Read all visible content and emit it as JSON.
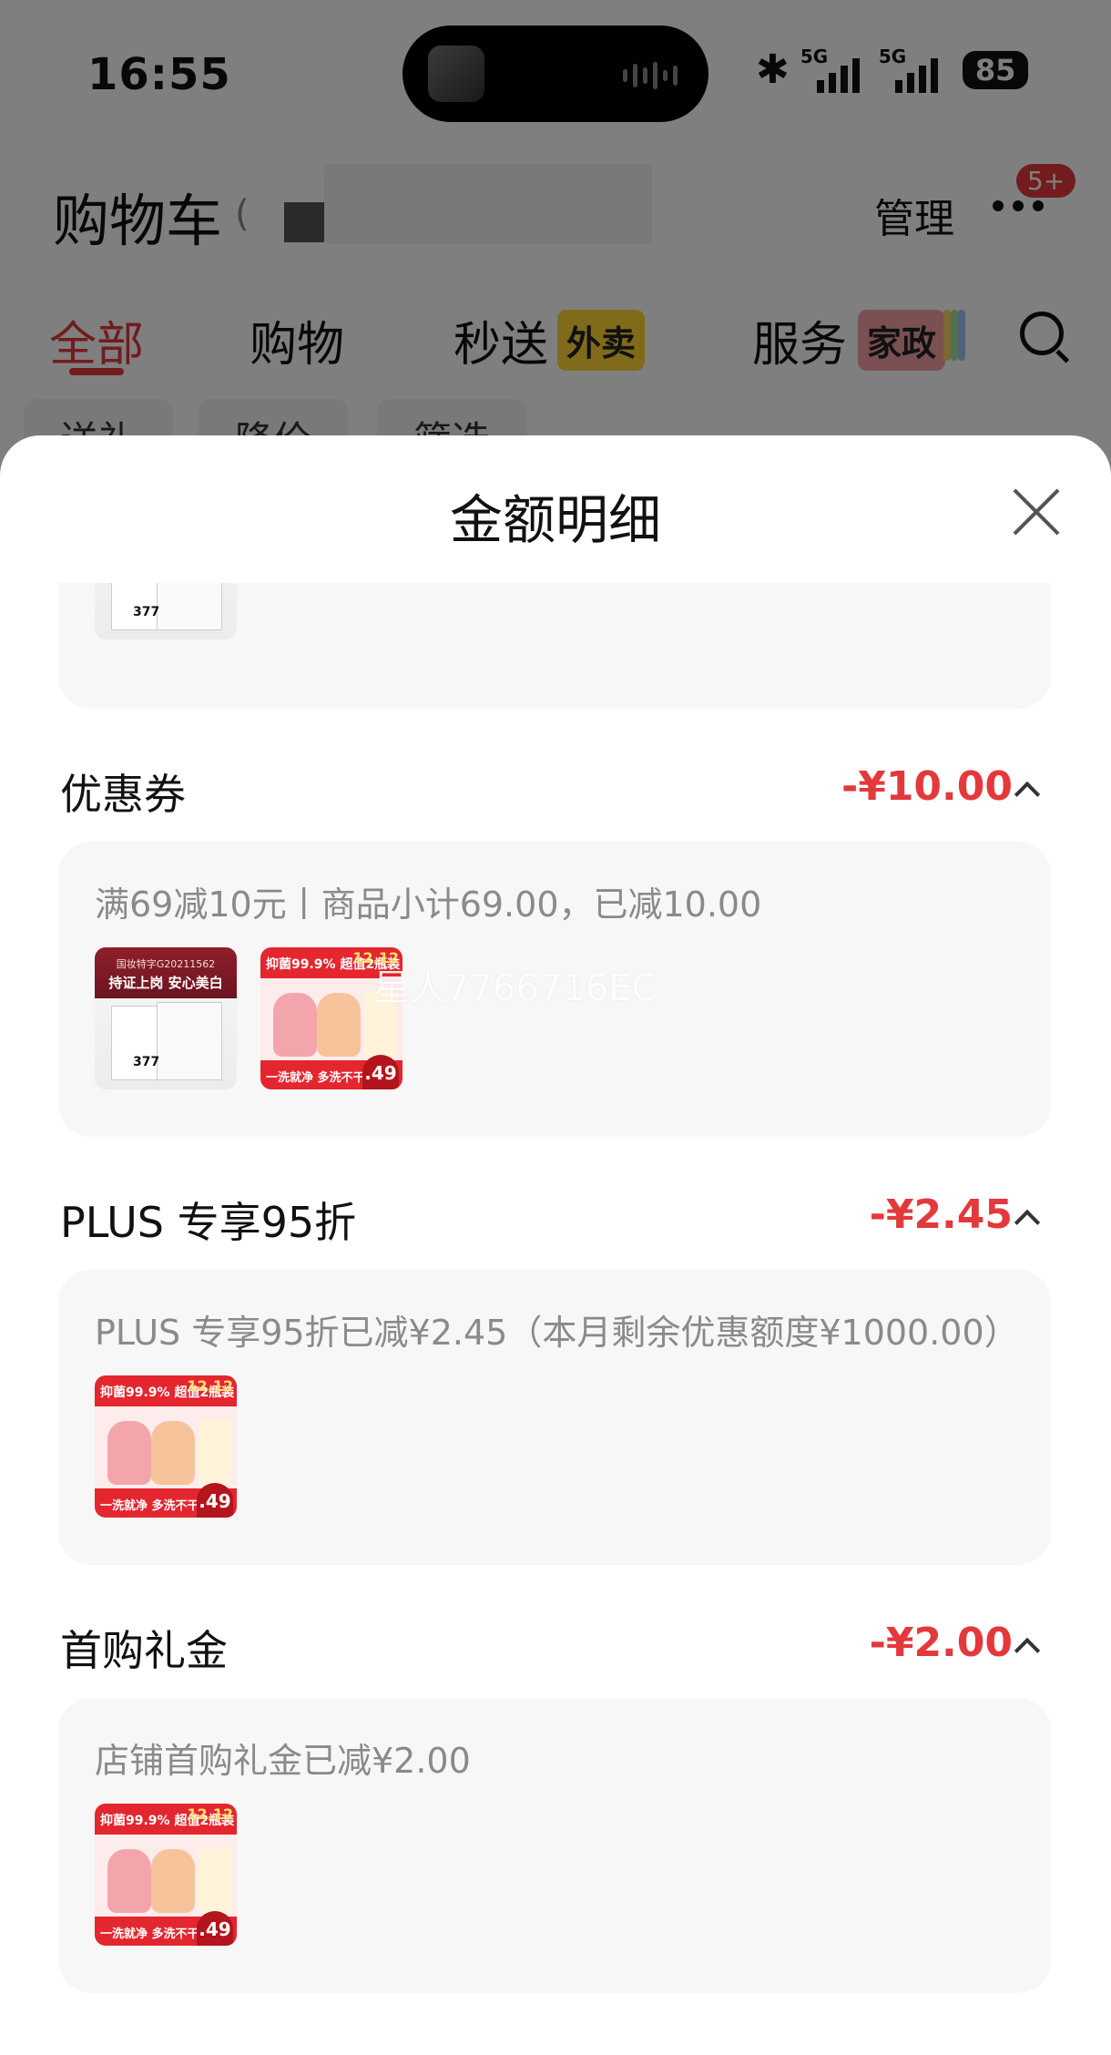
{
  "status_bar": {
    "time": "16:55",
    "network1": "5G",
    "network2": "5G",
    "battery": "85"
  },
  "header": {
    "title": "购物车",
    "count_partial": "(",
    "manage": "管理",
    "msg_badge": "5+"
  },
  "tabs": [
    {
      "label": "全部",
      "active": true
    },
    {
      "label": "购物"
    },
    {
      "label": "秒送",
      "tag": "外卖"
    },
    {
      "label": "服务",
      "tag": "家政"
    }
  ],
  "chips": [
    "送礼",
    "降价",
    "筛选"
  ],
  "sheet": {
    "title": "金额明细",
    "sections": [
      {
        "label": "优惠券",
        "amount": "-¥10.00",
        "desc": "满69减10元丨商品小计69.00，已减10.00",
        "products": [
          "product-a",
          "product-b"
        ]
      },
      {
        "label": "PLUS 专享95折",
        "amount": "-¥2.45",
        "desc": "PLUS 专享95折已减¥2.45（本月剩余优惠额度¥1000.00）",
        "products": [
          "product-b"
        ]
      },
      {
        "label": "首购礼金",
        "amount": "-¥2.00",
        "desc": "店铺首购礼金已减¥2.00",
        "products": [
          "product-b"
        ]
      }
    ]
  },
  "product_a": {
    "line1": "国妆特字G20211562",
    "line2": "持证上岗 安心美白",
    "num": "377"
  },
  "product_b": {
    "title": "抑菌99.9% 超值2瓶装",
    "date": "12.12",
    "foot": "一洗就净 多洗不干",
    "price": ".49"
  },
  "watermark": "星人7766716EC",
  "colors": {
    "accent": "#e4393c",
    "sheet_bg": "#ffffff",
    "card_bg": "#f7f7f7"
  }
}
